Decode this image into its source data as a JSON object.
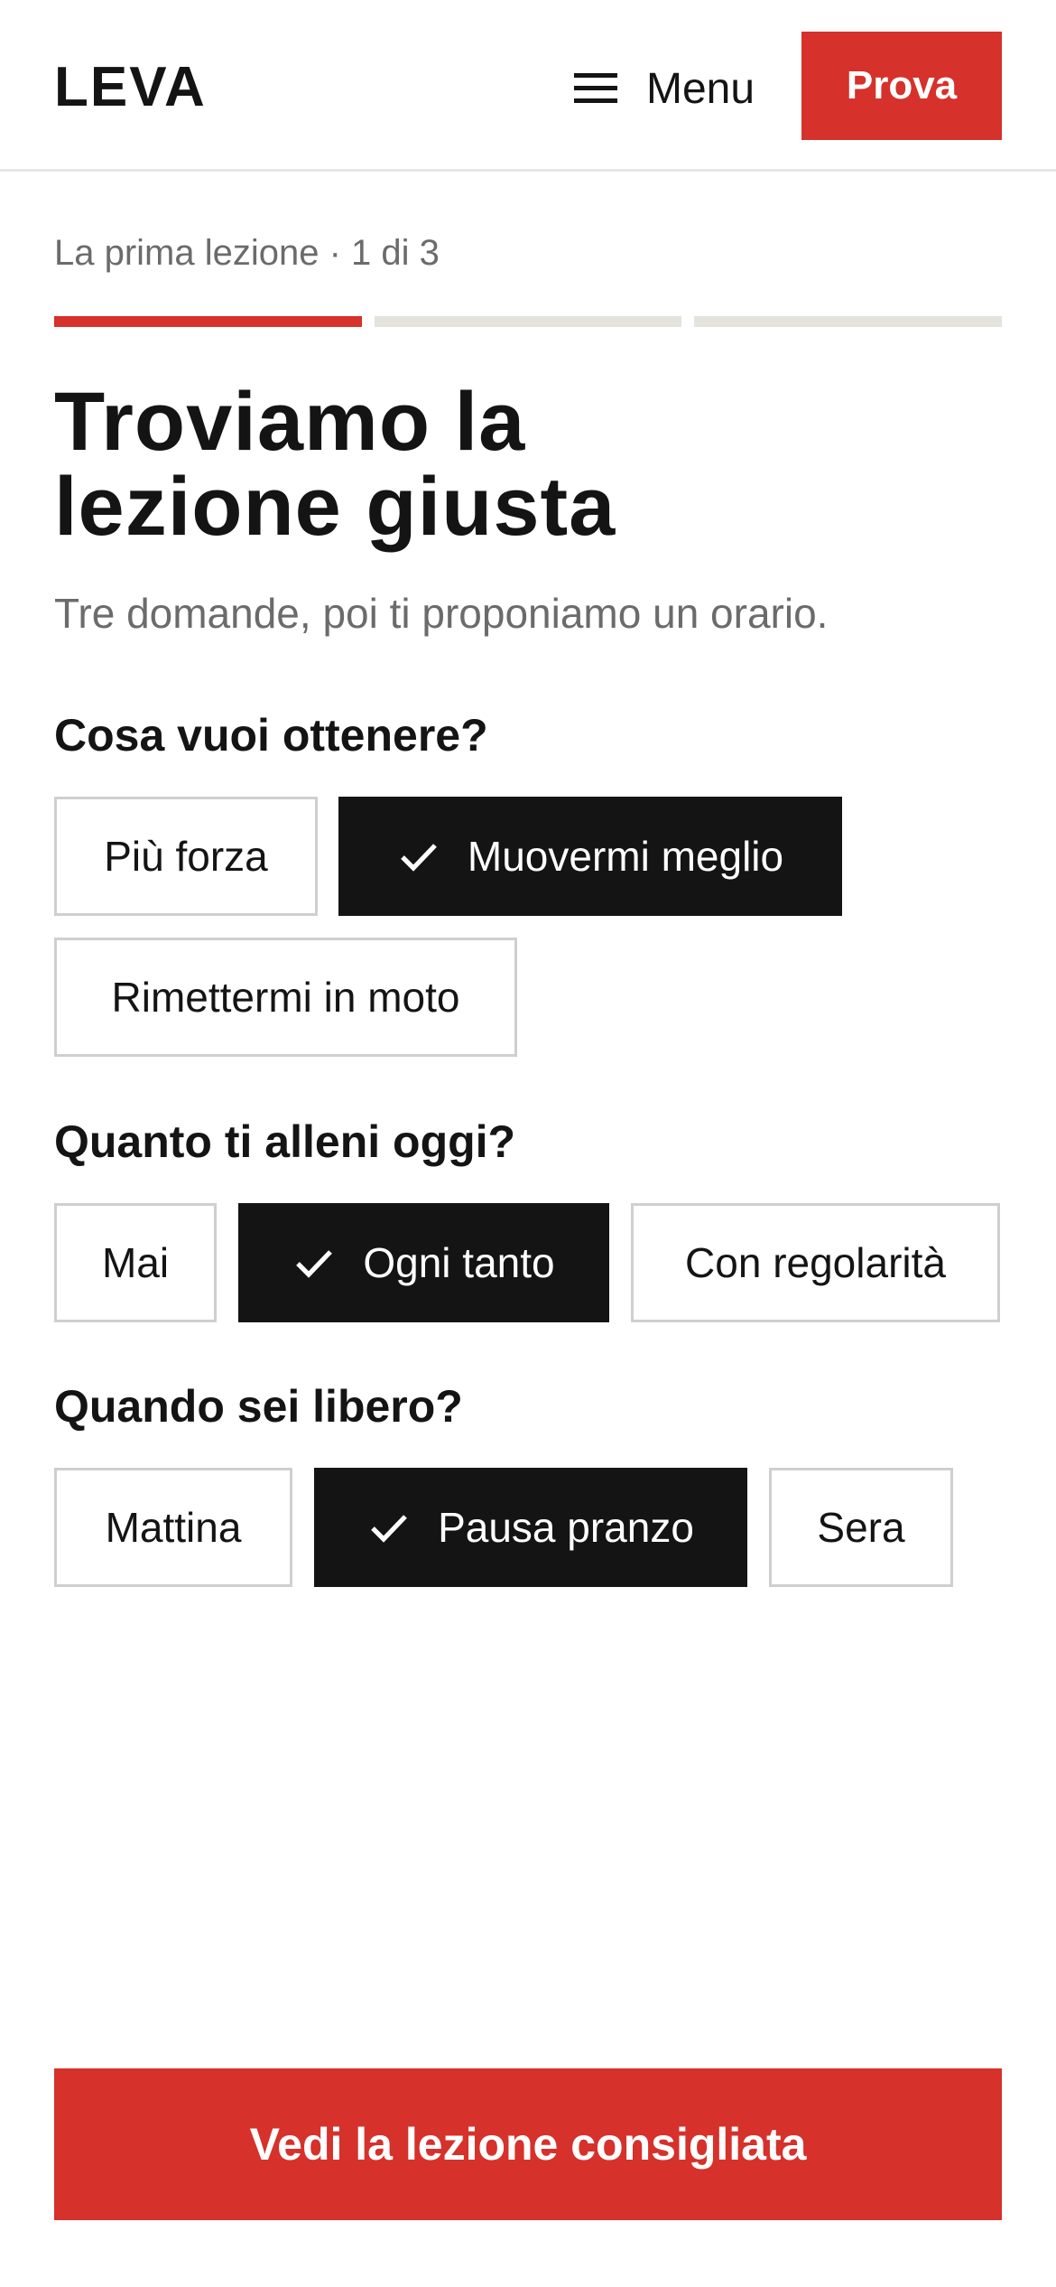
{
  "header": {
    "logo": "LEVA",
    "menu_label": "Menu",
    "menu_icon": "hamburger-icon",
    "cta_label": "Prova"
  },
  "progress": {
    "label": "La prima lezione · 1 di 3",
    "current_step": 1,
    "total_steps": 3
  },
  "intro": {
    "title_line1": "Troviamo la",
    "title_line2": "lezione giusta",
    "subtitle": "Tre domande, poi ti proponiamo un orario."
  },
  "questions": [
    {
      "label": "Cosa vuoi ottenere?",
      "options": [
        "Più forza",
        "Muovermi meglio",
        "Rimettermi in moto"
      ],
      "selected": "Muovermi meglio"
    },
    {
      "label": "Quanto ti alleni oggi?",
      "options": [
        "Mai",
        "Ogni tanto",
        "Con regolarità"
      ],
      "selected": "Ogni tanto"
    },
    {
      "label": "Quando sei libero?",
      "options": [
        "Mattina",
        "Pausa pranzo",
        "Sera"
      ],
      "selected": "Pausa pranzo"
    }
  ],
  "footer": {
    "cta_label": "Vedi la lezione consigliata"
  },
  "colors": {
    "accent": "#d6312b",
    "ink": "#141414",
    "muted": "#6b6b6b",
    "track": "#e4e3dd"
  },
  "icons": {
    "selected_marker": "checkmark-icon"
  }
}
